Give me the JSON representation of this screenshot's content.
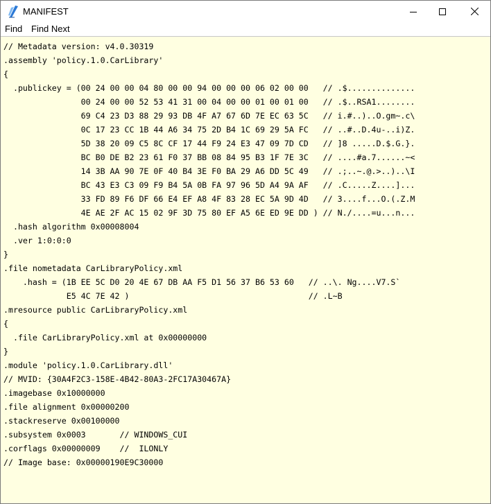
{
  "window": {
    "title": "MANIFEST",
    "icons": {
      "app": "ildasm-pen-icon",
      "minimize": "minimize-icon",
      "maximize": "maximize-icon",
      "close": "close-icon"
    }
  },
  "menu": {
    "items": [
      "Find",
      "Find Next"
    ]
  },
  "code_lines": [
    "// Metadata version: v4.0.30319",
    ".assembly 'policy.1.0.CarLibrary'",
    "{",
    "  .publickey = (00 24 00 00 04 80 00 00 94 00 00 00 06 02 00 00   // .$..............",
    "                00 24 00 00 52 53 41 31 00 04 00 00 01 00 01 00   // .$..RSA1........",
    "                69 C4 23 D3 88 29 93 DB 4F A7 67 6D 7E EC 63 5C   // i.#..)..O.gm~.c\\",
    "                0C 17 23 CC 1B 44 A6 34 75 2D B4 1C 69 29 5A FC   // ..#..D.4u-..i)Z.",
    "                5D 38 20 09 C5 8C CF 17 44 F9 24 E3 47 09 7D CD   // ]8 .....D.$.G.}.",
    "                BC B0 DE B2 23 61 F0 37 BB 08 84 95 B3 1F 7E 3C   // ....#a.7......~<",
    "                14 3B AA 90 7E 0F 40 B4 3E F0 BA 29 A6 DD 5C 49   // .;..~.@.>..)..\\I",
    "                BC 43 E3 C3 09 F9 B4 5A 0B FA 97 96 5D A4 9A AF   // .C.....Z....]...",
    "                33 FD 89 F6 DF 66 E4 EF A8 4F 83 28 EC 5A 9D 4D   // 3....f...O.(.Z.M",
    "                4E AE 2F AC 15 02 9F 3D 75 80 EF A5 6E ED 9E DD ) // N./....=u...n...",
    "  .hash algorithm 0x00008004",
    "  .ver 1:0:0:0",
    "}",
    ".file nometadata CarLibraryPolicy.xml",
    "    .hash = (1B EE 5C D0 20 4E 67 DB AA F5 D1 56 37 B6 53 60   // ..\\. Ng....V7.S`",
    "             E5 4C 7E 42 )                                     // .L~B",
    ".mresource public CarLibraryPolicy.xml",
    "{",
    "  .file CarLibraryPolicy.xml at 0x00000000",
    "}",
    ".module 'policy.1.0.CarLibrary.dll'",
    "// MVID: {30A4F2C3-158E-4B42-80A3-2FC17A30467A}",
    ".imagebase 0x10000000",
    ".file alignment 0x00000200",
    ".stackreserve 0x00100000",
    ".subsystem 0x0003       // WINDOWS_CUI",
    ".corflags 0x00000009    //  ILONLY",
    "// Image base: 0x00000190E9C30000"
  ]
}
